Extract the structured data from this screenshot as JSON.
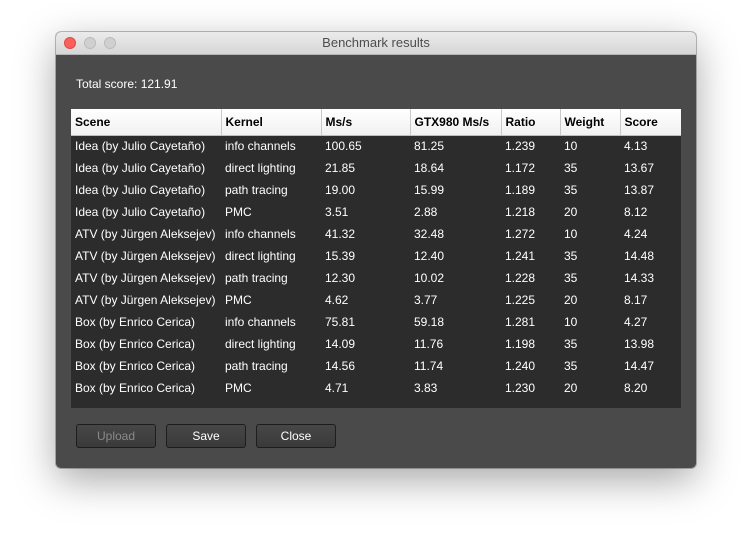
{
  "window": {
    "title": "Benchmark results"
  },
  "total": {
    "label": "Total score: 121.91"
  },
  "table": {
    "columns": [
      "Scene",
      "Kernel",
      "Ms/s",
      "GTX980 Ms/s",
      "Ratio",
      "Weight",
      "Score"
    ],
    "rows": [
      [
        "Idea (by Julio Cayetaño)",
        "info channels",
        "100.65",
        "81.25",
        "1.239",
        "10",
        "4.13"
      ],
      [
        "Idea (by Julio Cayetaño)",
        "direct lighting",
        "21.85",
        "18.64",
        "1.172",
        "35",
        "13.67"
      ],
      [
        "Idea (by Julio Cayetaño)",
        "path tracing",
        "19.00",
        "15.99",
        "1.189",
        "35",
        "13.87"
      ],
      [
        "Idea (by Julio Cayetaño)",
        "PMC",
        "3.51",
        "2.88",
        "1.218",
        "20",
        "8.12"
      ],
      [
        "ATV (by Jürgen Aleksejev)",
        "info channels",
        "41.32",
        "32.48",
        "1.272",
        "10",
        "4.24"
      ],
      [
        "ATV (by Jürgen Aleksejev)",
        "direct lighting",
        "15.39",
        "12.40",
        "1.241",
        "35",
        "14.48"
      ],
      [
        "ATV (by Jürgen Aleksejev)",
        "path tracing",
        "12.30",
        "10.02",
        "1.228",
        "35",
        "14.33"
      ],
      [
        "ATV (by Jürgen Aleksejev)",
        "PMC",
        "4.62",
        "3.77",
        "1.225",
        "20",
        "8.17"
      ],
      [
        "Box (by Enrico Cerica)",
        "info channels",
        "75.81",
        "59.18",
        "1.281",
        "10",
        "4.27"
      ],
      [
        "Box (by Enrico Cerica)",
        "direct lighting",
        "14.09",
        "11.76",
        "1.198",
        "35",
        "13.98"
      ],
      [
        "Box (by Enrico Cerica)",
        "path tracing",
        "14.56",
        "11.74",
        "1.240",
        "35",
        "14.47"
      ],
      [
        "Box (by Enrico Cerica)",
        "PMC",
        "4.71",
        "3.83",
        "1.230",
        "20",
        "8.20"
      ]
    ]
  },
  "buttons": {
    "upload": "Upload",
    "save": "Save",
    "close": "Close"
  }
}
